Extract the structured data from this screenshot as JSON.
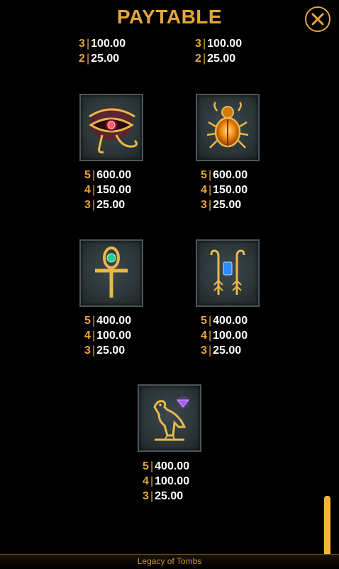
{
  "header": {
    "title": "PAYTABLE",
    "close_icon": "close-icon"
  },
  "partial_rows": [
    {
      "label_left": {
        "count": "3",
        "value": "100.00"
      },
      "label_right": {
        "count": "3",
        "value": "100.00"
      }
    },
    {
      "label_left": {
        "count": "2",
        "value": "25.00"
      },
      "label_right": {
        "count": "2",
        "value": "25.00"
      }
    }
  ],
  "symbols": [
    {
      "icon": "eye-of-horus-icon",
      "pays": [
        {
          "count": "5",
          "value": "600.00"
        },
        {
          "count": "4",
          "value": "150.00"
        },
        {
          "count": "3",
          "value": "25.00"
        }
      ]
    },
    {
      "icon": "scarab-icon",
      "pays": [
        {
          "count": "5",
          "value": "600.00"
        },
        {
          "count": "4",
          "value": "150.00"
        },
        {
          "count": "3",
          "value": "25.00"
        }
      ]
    },
    {
      "icon": "ankh-icon",
      "pays": [
        {
          "count": "5",
          "value": "400.00"
        },
        {
          "count": "4",
          "value": "100.00"
        },
        {
          "count": "3",
          "value": "25.00"
        }
      ]
    },
    {
      "icon": "crook-and-flail-icon",
      "pays": [
        {
          "count": "5",
          "value": "400.00"
        },
        {
          "count": "4",
          "value": "100.00"
        },
        {
          "count": "3",
          "value": "25.00"
        }
      ]
    },
    {
      "icon": "falcon-icon",
      "pays": [
        {
          "count": "5",
          "value": "400.00"
        },
        {
          "count": "4",
          "value": "100.00"
        },
        {
          "count": "3",
          "value": "25.00"
        }
      ]
    }
  ],
  "footer": {
    "game_name": "Legacy of Tombs"
  },
  "colors": {
    "gold": "#e7a63a",
    "background": "#000000",
    "tile": "#2c3537"
  }
}
